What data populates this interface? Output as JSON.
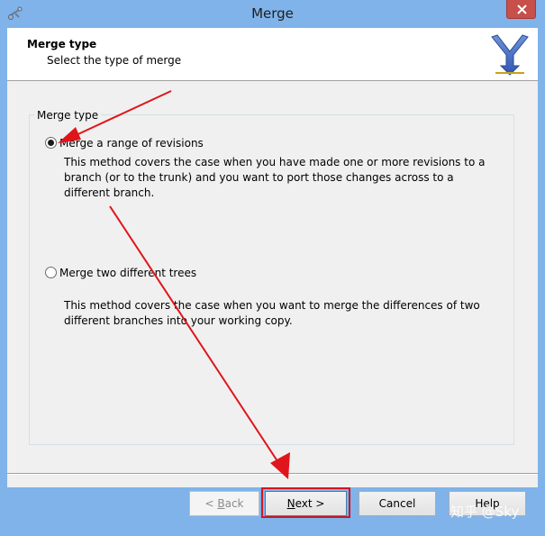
{
  "window": {
    "title": "Merge",
    "icon": "merge-app-icon",
    "close_icon": "close-icon"
  },
  "header": {
    "title": "Merge type",
    "subtitle": "Select the type of merge",
    "logo_icon": "merge-logo-icon"
  },
  "group": {
    "legend": "Merge type",
    "options": [
      {
        "label": "Merge a range of revisions",
        "selected": true,
        "description": "This method covers the case when you have made one or more revisions to a branch (or to the trunk) and you want to port those changes across to a different branch."
      },
      {
        "label": "Merge two different trees",
        "selected": false,
        "description": "This method covers the case when you want to merge the differences of two different branches into your working copy."
      }
    ]
  },
  "buttons": {
    "back": {
      "prefix": "< ",
      "mnemonic": "B",
      "rest": "ack",
      "enabled": false
    },
    "next": {
      "mnemonic": "N",
      "rest": "ext >",
      "enabled": true
    },
    "cancel": {
      "label": "Cancel"
    },
    "help": {
      "label": "Help"
    }
  },
  "annotations": {
    "arrow_color": "#e0151b",
    "highlight_color": "#d4141c"
  },
  "watermark": "知乎 @Sky",
  "colors": {
    "frame": "#7fb3ea",
    "close": "#c7504a",
    "dialog_bg": "#f0f0f0"
  }
}
